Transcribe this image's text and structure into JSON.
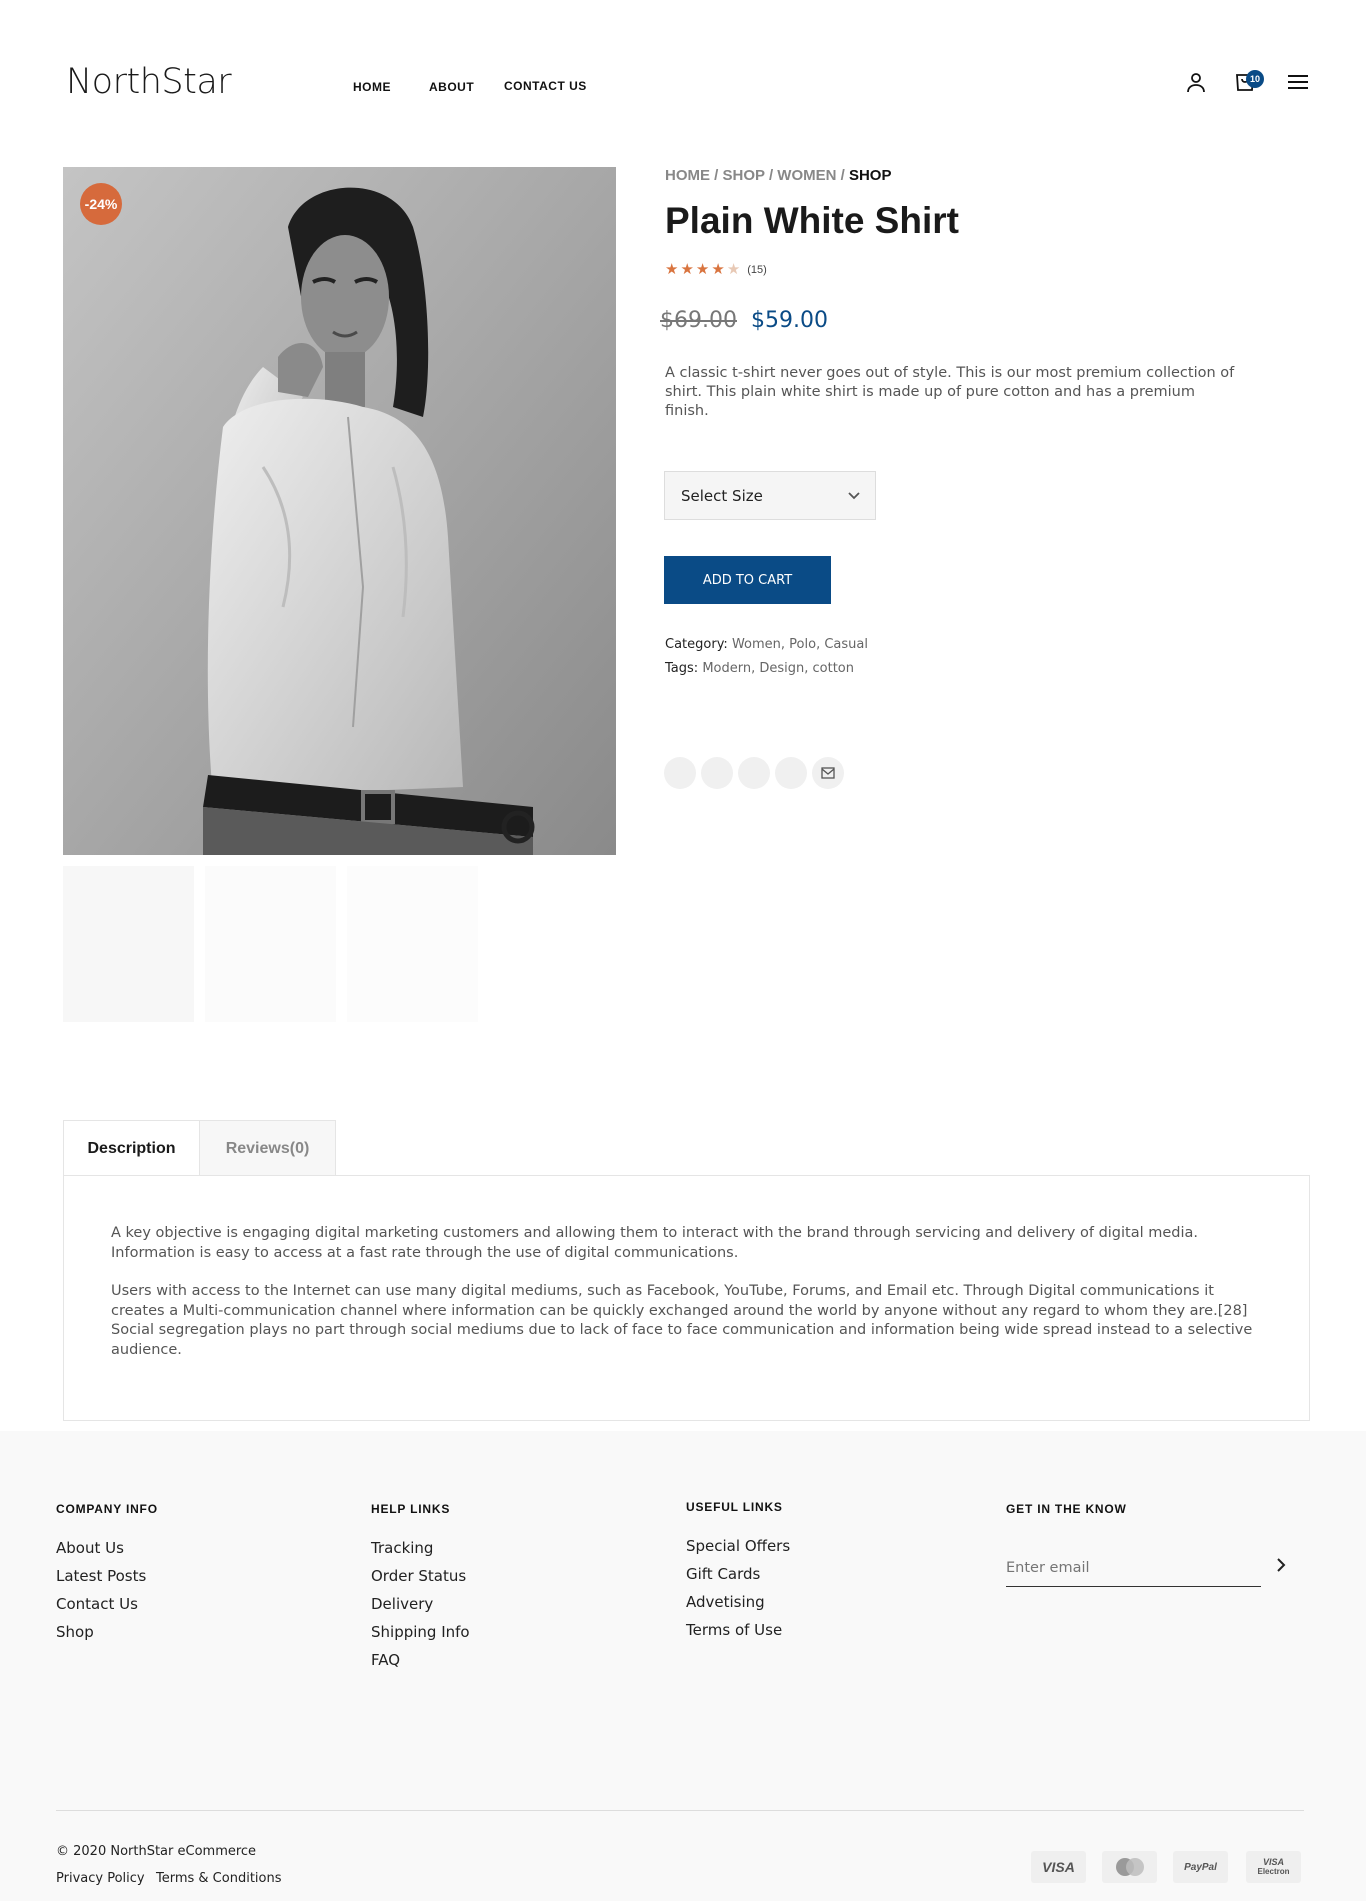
{
  "brand": {
    "logo_text": "NorthStar"
  },
  "nav": {
    "home": "HOME",
    "about": "ABOUT",
    "contact": "CONTACT US"
  },
  "header": {
    "cart_count": "10",
    "icons": [
      "user-icon",
      "cart-icon",
      "menu-icon"
    ]
  },
  "product": {
    "sale_badge": "-24%",
    "breadcrumb": {
      "home": "HOME",
      "shop": "SHOP",
      "women": "WOMEN",
      "current": "SHOP",
      "separator": "/"
    },
    "title": "Plain White Shirt",
    "rating": 4,
    "rating_max": 5,
    "review_count": "(15)",
    "old_price": "$69.00",
    "new_price": "$59.00",
    "short_description": "A classic t-shirt never goes out of style. This is our most premium collection of shirt. This plain white shirt is made up of pure cotton and has a premium finish.",
    "size_select_label": "Select Size",
    "add_to_cart_label": "ADD TO CART",
    "category_label": "Category:",
    "category_value": "Women, Polo, Casual",
    "tags_label": "Tags:",
    "tags_value": "Modern, Design, cotton",
    "share_icons": [
      "facebook-icon",
      "twitter-icon",
      "pinterest-icon",
      "linkedin-icon",
      "email-icon"
    ]
  },
  "tabs": {
    "description_label": "Description",
    "reviews_label": "Reviews(0)",
    "paragraphs": [
      "A key objective is engaging digital marketing customers and allowing them to interact with the brand through servicing and delivery of digital media. Information is easy to access at a fast rate through the use of digital communications.",
      "Users with access to the Internet can use many digital mediums, such as Facebook, YouTube, Forums, and Email etc. Through Digital communications it creates a Multi-communication channel where information can be quickly exchanged around the world by anyone without any regard to whom they are.[28] Social segregation plays no part through social mediums due to lack of face to face communication and information being wide spread instead to a selective audience."
    ]
  },
  "footer": {
    "company_info": {
      "title": "COMPANY INFO",
      "links": [
        "About Us",
        "Latest Posts",
        "Contact Us",
        "Shop"
      ]
    },
    "help_links": {
      "title": "HELP LINKS",
      "links": [
        "Tracking",
        "Order Status",
        "Delivery",
        "Shipping Info",
        "FAQ"
      ]
    },
    "useful_links": {
      "title": "USEFUL LINKS",
      "links": [
        "Special Offers",
        "Gift Cards",
        "Advetising",
        "Terms of Use"
      ]
    },
    "newsletter": {
      "title": "GET IN THE KNOW",
      "placeholder": "Enter email"
    },
    "copyright": "© 2020 NorthStar eCommerce",
    "privacy": "Privacy Policy",
    "terms": "Terms & Conditions",
    "payments": {
      "visa": "VISA",
      "mastercard": "MasterCard",
      "paypal": "PayPal",
      "visa_electron_1": "VISA",
      "visa_electron_2": "Electron"
    }
  },
  "colors": {
    "accent": "#0a4b86",
    "sale": "#d66a3c",
    "star": "#d9743f",
    "star_empty": "#e8c9b5"
  }
}
